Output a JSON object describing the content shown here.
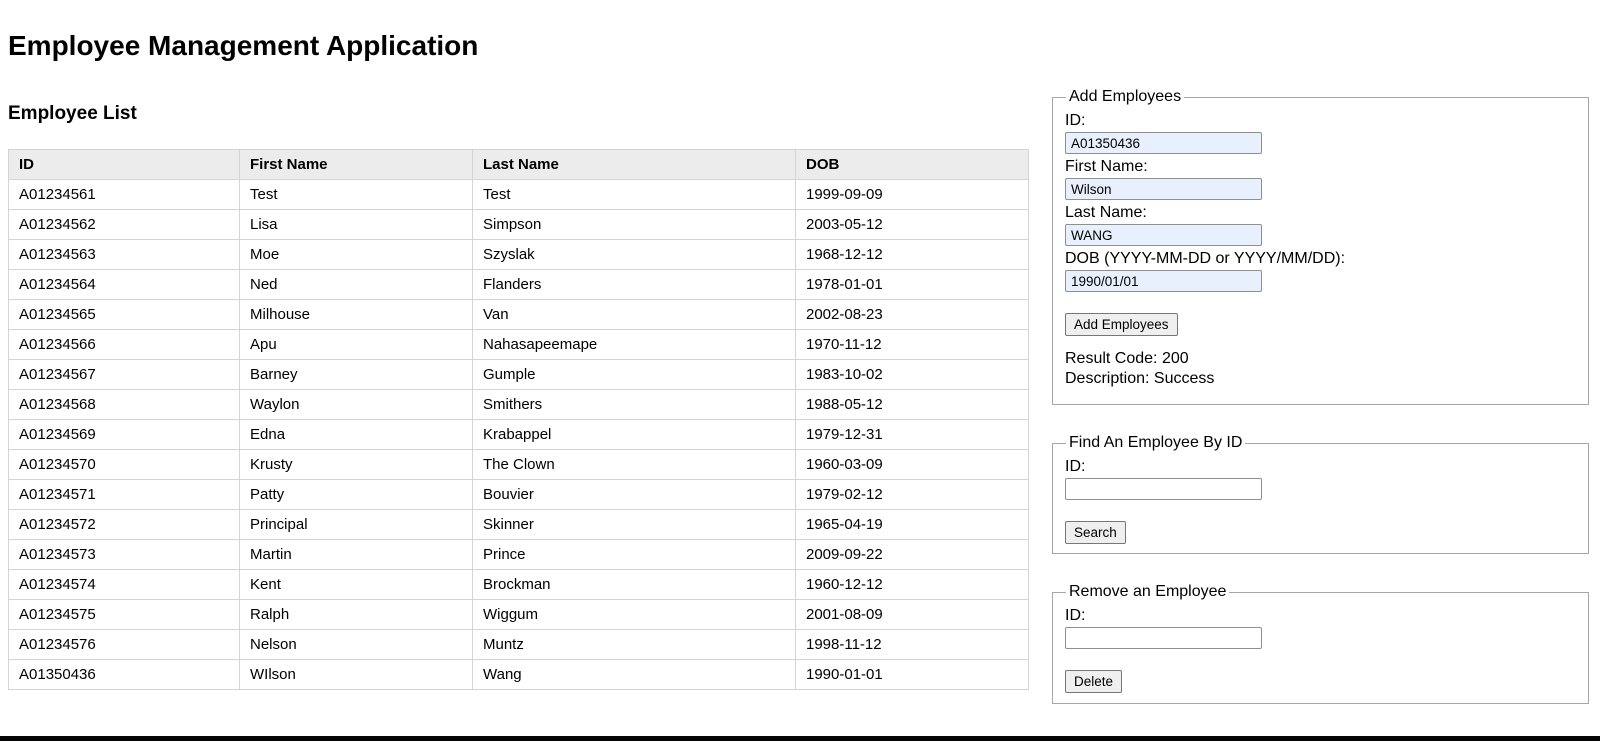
{
  "app": {
    "title": "Employee Management Application"
  },
  "employee_list": {
    "heading": "Employee List",
    "columns": [
      "ID",
      "First Name",
      "Last Name",
      "DOB"
    ],
    "rows": [
      {
        "id": "A01234561",
        "first_name": "Test",
        "last_name": "Test",
        "dob": "1999-09-09"
      },
      {
        "id": "A01234562",
        "first_name": "Lisa",
        "last_name": "Simpson",
        "dob": "2003-05-12"
      },
      {
        "id": "A01234563",
        "first_name": "Moe",
        "last_name": "Szyslak",
        "dob": "1968-12-12"
      },
      {
        "id": "A01234564",
        "first_name": "Ned",
        "last_name": "Flanders",
        "dob": "1978-01-01"
      },
      {
        "id": "A01234565",
        "first_name": "Milhouse",
        "last_name": "Van",
        "dob": "2002-08-23"
      },
      {
        "id": "A01234566",
        "first_name": "Apu",
        "last_name": "Nahasapeemape",
        "dob": "1970-11-12"
      },
      {
        "id": "A01234567",
        "first_name": "Barney",
        "last_name": "Gumple",
        "dob": "1983-10-02"
      },
      {
        "id": "A01234568",
        "first_name": "Waylon",
        "last_name": "Smithers",
        "dob": "1988-05-12"
      },
      {
        "id": "A01234569",
        "first_name": "Edna",
        "last_name": "Krabappel",
        "dob": "1979-12-31"
      },
      {
        "id": "A01234570",
        "first_name": "Krusty",
        "last_name": "The Clown",
        "dob": "1960-03-09"
      },
      {
        "id": "A01234571",
        "first_name": "Patty",
        "last_name": "Bouvier",
        "dob": "1979-02-12"
      },
      {
        "id": "A01234572",
        "first_name": "Principal",
        "last_name": "Skinner",
        "dob": "1965-04-19"
      },
      {
        "id": "A01234573",
        "first_name": "Martin",
        "last_name": "Prince",
        "dob": "2009-09-22"
      },
      {
        "id": "A01234574",
        "first_name": "Kent",
        "last_name": "Brockman",
        "dob": "1960-12-12"
      },
      {
        "id": "A01234575",
        "first_name": "Ralph",
        "last_name": "Wiggum",
        "dob": "2001-08-09"
      },
      {
        "id": "A01234576",
        "first_name": "Nelson",
        "last_name": "Muntz",
        "dob": "1998-11-12"
      },
      {
        "id": "A01350436",
        "first_name": "WIlson",
        "last_name": "Wang",
        "dob": "1990-01-01"
      }
    ]
  },
  "add_panel": {
    "legend": "Add Employees",
    "id_label": "ID:",
    "id_value": "A01350436",
    "first_name_label": "First Name:",
    "first_name_value": "Wilson",
    "last_name_label": "Last Name:",
    "last_name_value": "WANG",
    "dob_label": "DOB (YYYY-MM-DD or YYYY/MM/DD):",
    "dob_value": "1990/01/01",
    "button_label": "Add Employees",
    "result_code_text": "Result Code: 200",
    "result_description_text": "Description: Success"
  },
  "find_panel": {
    "legend": "Find An Employee By ID",
    "id_label": "ID:",
    "id_value": "",
    "button_label": "Search"
  },
  "remove_panel": {
    "legend": "Remove an Employee",
    "id_label": "ID:",
    "id_value": "",
    "button_label": "Delete"
  },
  "colors": {
    "autofill_input_bg": "#e8f0fe",
    "table_header_bg": "#ececec",
    "table_border": "#d4d4d4",
    "fieldset_border": "#a6a6a6",
    "button_bg": "#efefef",
    "button_border": "#767676",
    "bottom_bar": "#000000"
  }
}
